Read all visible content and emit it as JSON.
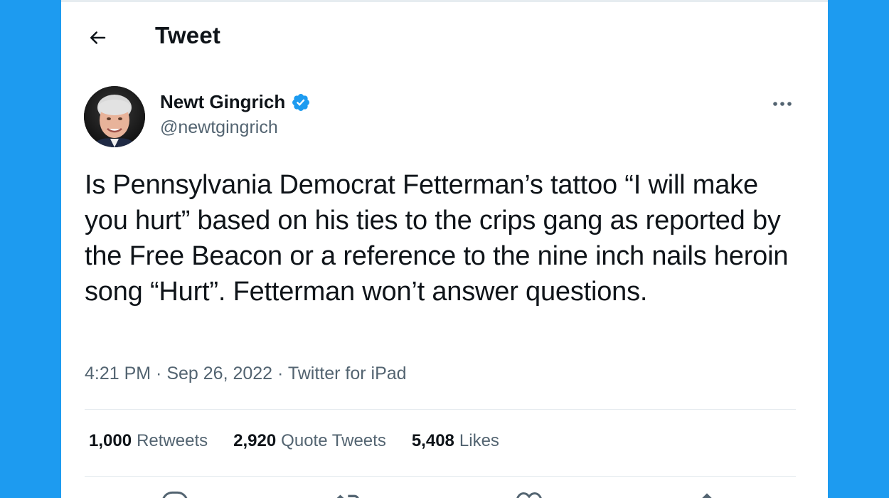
{
  "header": {
    "title": "Tweet",
    "back_icon": "arrow-left-icon"
  },
  "author": {
    "name": "Newt Gingrich",
    "handle": "@newtgingrich",
    "verified_icon": "verified-badge-icon",
    "verified_color": "#1d9bf0"
  },
  "tweet": {
    "text": "Is Pennsylvania Democrat Fetterman’s tattoo “I will make you hurt” based on his ties to the crips gang as reported by the Free Beacon or a reference to the nine inch nails heroin song “Hurt”. Fetterman won’t answer questions.",
    "time": "4:21 PM",
    "date": "Sep 26, 2022",
    "source": "Twitter for iPad",
    "separator": " · "
  },
  "stats": [
    {
      "count": "1,000",
      "label": "Retweets"
    },
    {
      "count": "2,920",
      "label": "Quote Tweets"
    },
    {
      "count": "5,408",
      "label": "Likes"
    }
  ],
  "actions": [
    "reply-icon",
    "retweet-icon",
    "like-icon",
    "share-icon"
  ],
  "colors": {
    "background": "#1d9bf0",
    "card": "#ffffff",
    "text": "#0f1419",
    "secondary": "#536471",
    "divider": "#e6ecf0"
  }
}
